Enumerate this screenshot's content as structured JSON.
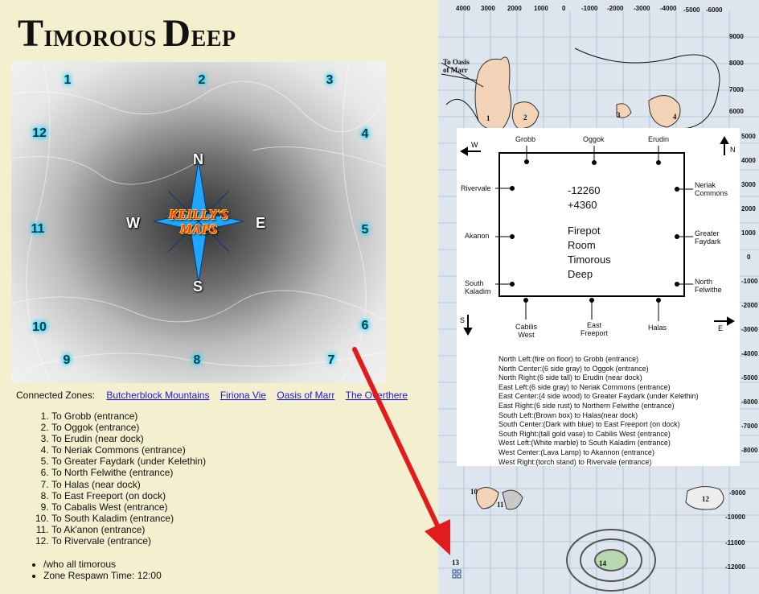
{
  "title": {
    "t1": "T",
    "t2": "IMOROUS ",
    "t3": "D",
    "t4": "EEP"
  },
  "compass": {
    "points": [
      "1",
      "2",
      "3",
      "4",
      "5",
      "6",
      "7",
      "8",
      "9",
      "10",
      "11",
      "12"
    ],
    "directions": {
      "n": "N",
      "s": "S",
      "e": "E",
      "w": "W"
    },
    "brand_line1": "KEILLY'S",
    "brand_line2": "MAPS"
  },
  "connected": {
    "label": "Connected Zones:",
    "links": [
      "Butcherblock Mountains",
      "Firiona Vie",
      "Oasis of Marr",
      "The Overthere"
    ]
  },
  "destinations": [
    "To Grobb (entrance)",
    "To Oggok (entrance)",
    "To Erudin (near dock)",
    "To Neriak Commons (entrance)",
    "To Greater Faydark (under Kelethin)",
    "To North Felwithe (entrance)",
    "To Halas (near dock)",
    "To East Freeport (on dock)",
    "To Cabalis West (entrance)",
    "To South Kaladim (entrance)",
    "To Ak'anon (entrance)",
    "To Rivervale (entrance)"
  ],
  "info": [
    "/who all timorous",
    "Zone Respawn Time: 12:00"
  ],
  "map": {
    "top_ticks": [
      "4000",
      "3000",
      "2000",
      "1000",
      "0",
      "-1000",
      "-2000",
      "-3000",
      "-4000",
      "-5000",
      "-6000"
    ],
    "right_ticks": [
      "9000",
      "8000",
      "7000",
      "6000",
      "5000",
      "4000",
      "3000",
      "2000",
      "1000",
      "0",
      "-1000",
      "-2000",
      "-3000",
      "-4000",
      "-5000",
      "-6000",
      "-7000",
      "-8000",
      "-9000",
      "-10000",
      "-11000",
      "-12000"
    ],
    "oasis_label_1": "To Oasis",
    "oasis_label_2": "of Marr",
    "island_labels": [
      "1",
      "2",
      "3",
      "4",
      "10",
      "11",
      "12",
      "13",
      "14"
    ]
  },
  "room": {
    "top": [
      "Grobb",
      "Oggok",
      "Erudin"
    ],
    "left": [
      "Rivervale",
      "Akanon",
      "South",
      "Kaladim"
    ],
    "right": [
      "Neriak",
      "Commons",
      "Greater",
      "Faydark",
      "North",
      "Felwithe"
    ],
    "bottom": [
      "Cabilis",
      "West",
      "East",
      "Freeport",
      "Halas"
    ],
    "coord1": "-12260",
    "coord2": "+4360",
    "name": [
      "Firepot",
      "Room",
      "Timorous",
      "Deep"
    ],
    "arrows": {
      "w": "W",
      "n": "N",
      "s": "S",
      "e": "E"
    },
    "notes": [
      "North Left:(fire on floor) to Grobb (entrance)",
      "North Center:(6 side gray) to Oggok (entrance)",
      "North Right:(6 side tall) to Erudin (near dock)",
      "East Left:(6 side gray) to Neriak Commons (entrance)",
      "East Center:(4 side wood) to Greater Faydark (under Kelethin)",
      "East Right:(6 side rust) to Northern Felwithe (entrance)",
      "South Left:(Brown box) to Halas(near dock)",
      "South Center:(Dark with blue) to East Freeport (on dock)",
      "South Right:(tall gold vase) to Cabilis West (entrance)",
      "West Left:(White marble) to South Kaladim (entrance)",
      "West Center:(Lava Lamp) to Akannon (entrance)",
      "West Right:(torch stand) to Rivervale (entrance)"
    ]
  },
  "colors": {
    "glow": "#20e0ff",
    "arrow": "#e01c1c",
    "link": "#1a1adb",
    "land": "#f3d3b8"
  }
}
